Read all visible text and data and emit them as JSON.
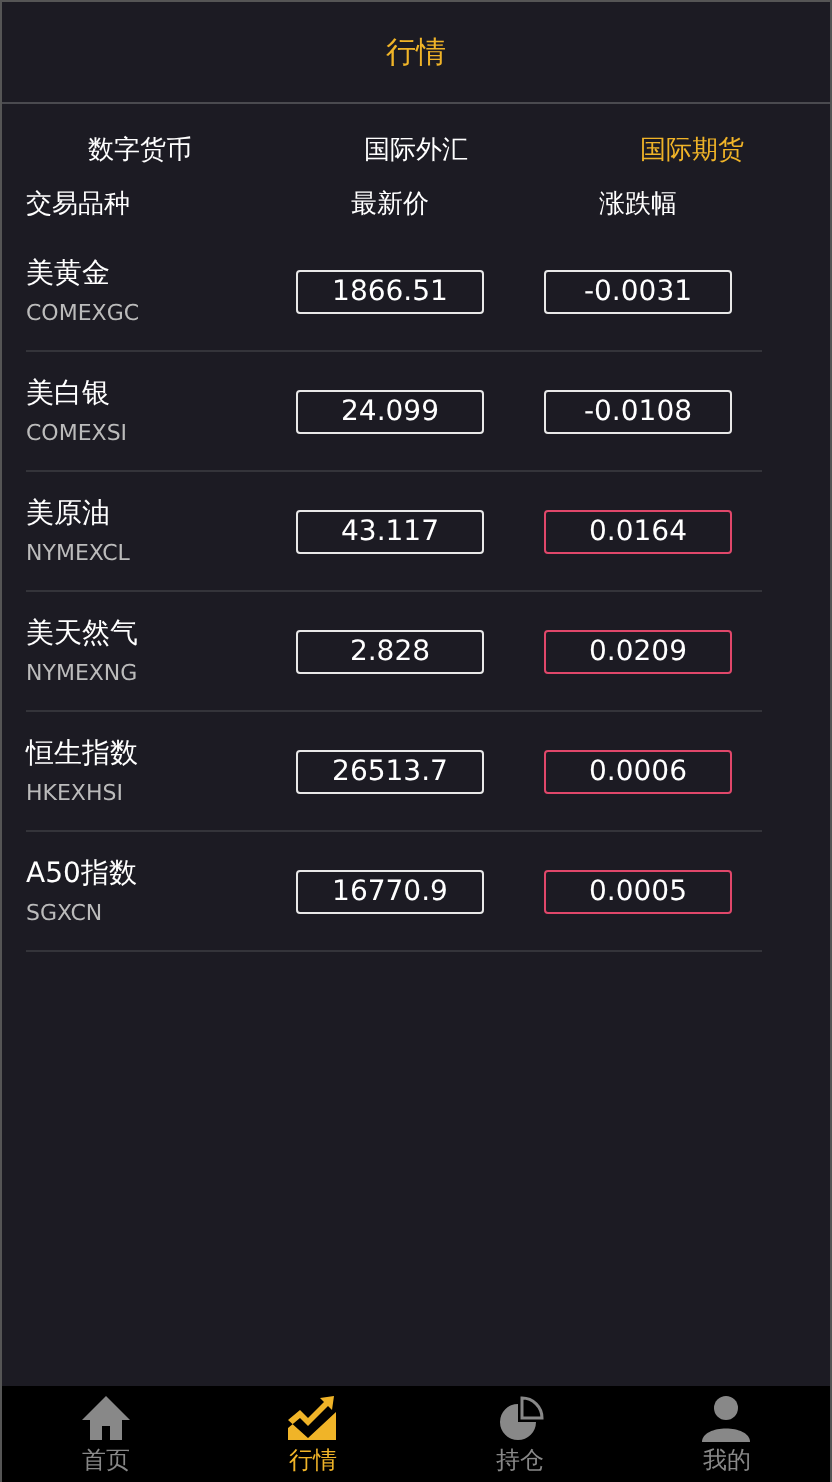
{
  "header": {
    "title": "行情"
  },
  "tabs": [
    {
      "label": "数字货币",
      "selected": false
    },
    {
      "label": "国际外汇",
      "selected": false
    },
    {
      "label": "国际期货",
      "selected": true
    }
  ],
  "table": {
    "columns": [
      "交易品种",
      "最新价",
      "涨跌幅"
    ],
    "rows": [
      {
        "name": "美黄金",
        "code": "COMEXGC",
        "price": "1866.51",
        "change": "-0.0031",
        "color": "#e8e8e8"
      },
      {
        "name": "美白银",
        "code": "COMEXSI",
        "price": "24.099",
        "change": "-0.0108",
        "color": "#e8e8e8"
      },
      {
        "name": "美原油",
        "code": "NYMEXCL",
        "price": "43.117",
        "change": "0.0164",
        "color": "#e0476a"
      },
      {
        "name": "美天然气",
        "code": "NYMEXNG",
        "price": "2.828",
        "change": "0.0209",
        "color": "#e0476a"
      },
      {
        "name": "恒生指数",
        "code": "HKEXHSI",
        "price": "26513.7",
        "change": "0.0006",
        "color": "#e0476a"
      },
      {
        "name": "A50指数",
        "code": "SGXCN",
        "price": "16770.9",
        "change": "0.0005",
        "color": "#e0476a"
      }
    ]
  },
  "bottom_nav": [
    {
      "label": "首页",
      "selected": false
    },
    {
      "label": "行情",
      "selected": true
    },
    {
      "label": "持仓",
      "selected": false
    },
    {
      "label": "我的",
      "selected": false
    }
  ]
}
